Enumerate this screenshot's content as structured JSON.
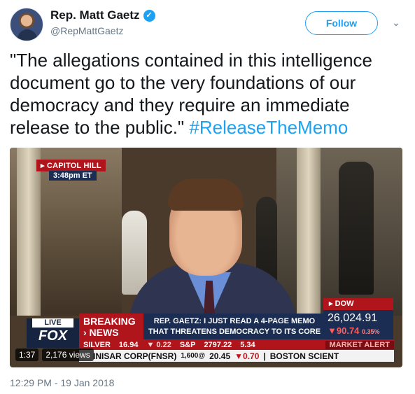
{
  "author": {
    "display_name": "Rep. Matt Gaetz",
    "handle": "@RepMattGaetz",
    "verified_icon": "verified-badge-icon"
  },
  "actions": {
    "follow_label": "Follow",
    "more_icon": "chevron-down-icon"
  },
  "tweet": {
    "text": "\"The allegations contained in this intelligence document go to the very foundations of our democracy and they require an immediate release to the public.\" ",
    "hashtag": "#ReleaseTheMemo",
    "timestamp": "12:29 PM - 19 Jan 2018"
  },
  "video": {
    "location_tag": "CAPITOL HILL",
    "location_time": "3:48pm ET",
    "channel_live": "LIVE",
    "channel_name": "FOX",
    "breaking_line1": "BREAKING",
    "breaking_line2": "› NEWS",
    "headline_line1": "REP. GAETZ: I JUST READ A 4-PAGE MEMO",
    "headline_line2": "THAT THREATENS DEMOCRACY TO ITS CORE",
    "index_name": "DOW",
    "index_value": "26,024.91",
    "index_change": "▼90.74",
    "index_change_pct": "0.35%",
    "market": {
      "silver_label": "SILVER",
      "silver_price": "16.94",
      "silver_change": "▼ 0.22",
      "sp_label": "S&P",
      "sp_value": "2797.22",
      "sp_change": "5.34",
      "alert": "MARKET ALERT"
    },
    "stock_ticker": {
      "prefix": "INISAR CORP(FNSR)",
      "volume": "1,600@",
      "price": "20.45",
      "change": "▼0.70",
      "next": "BOSTON SCIENT"
    },
    "duration": "1:37",
    "views": "2,176 views"
  },
  "colors": {
    "twitter_blue": "#1da1f2",
    "fox_red": "#b0151c",
    "fox_navy": "#1b2d52",
    "meta_gray": "#657786"
  }
}
